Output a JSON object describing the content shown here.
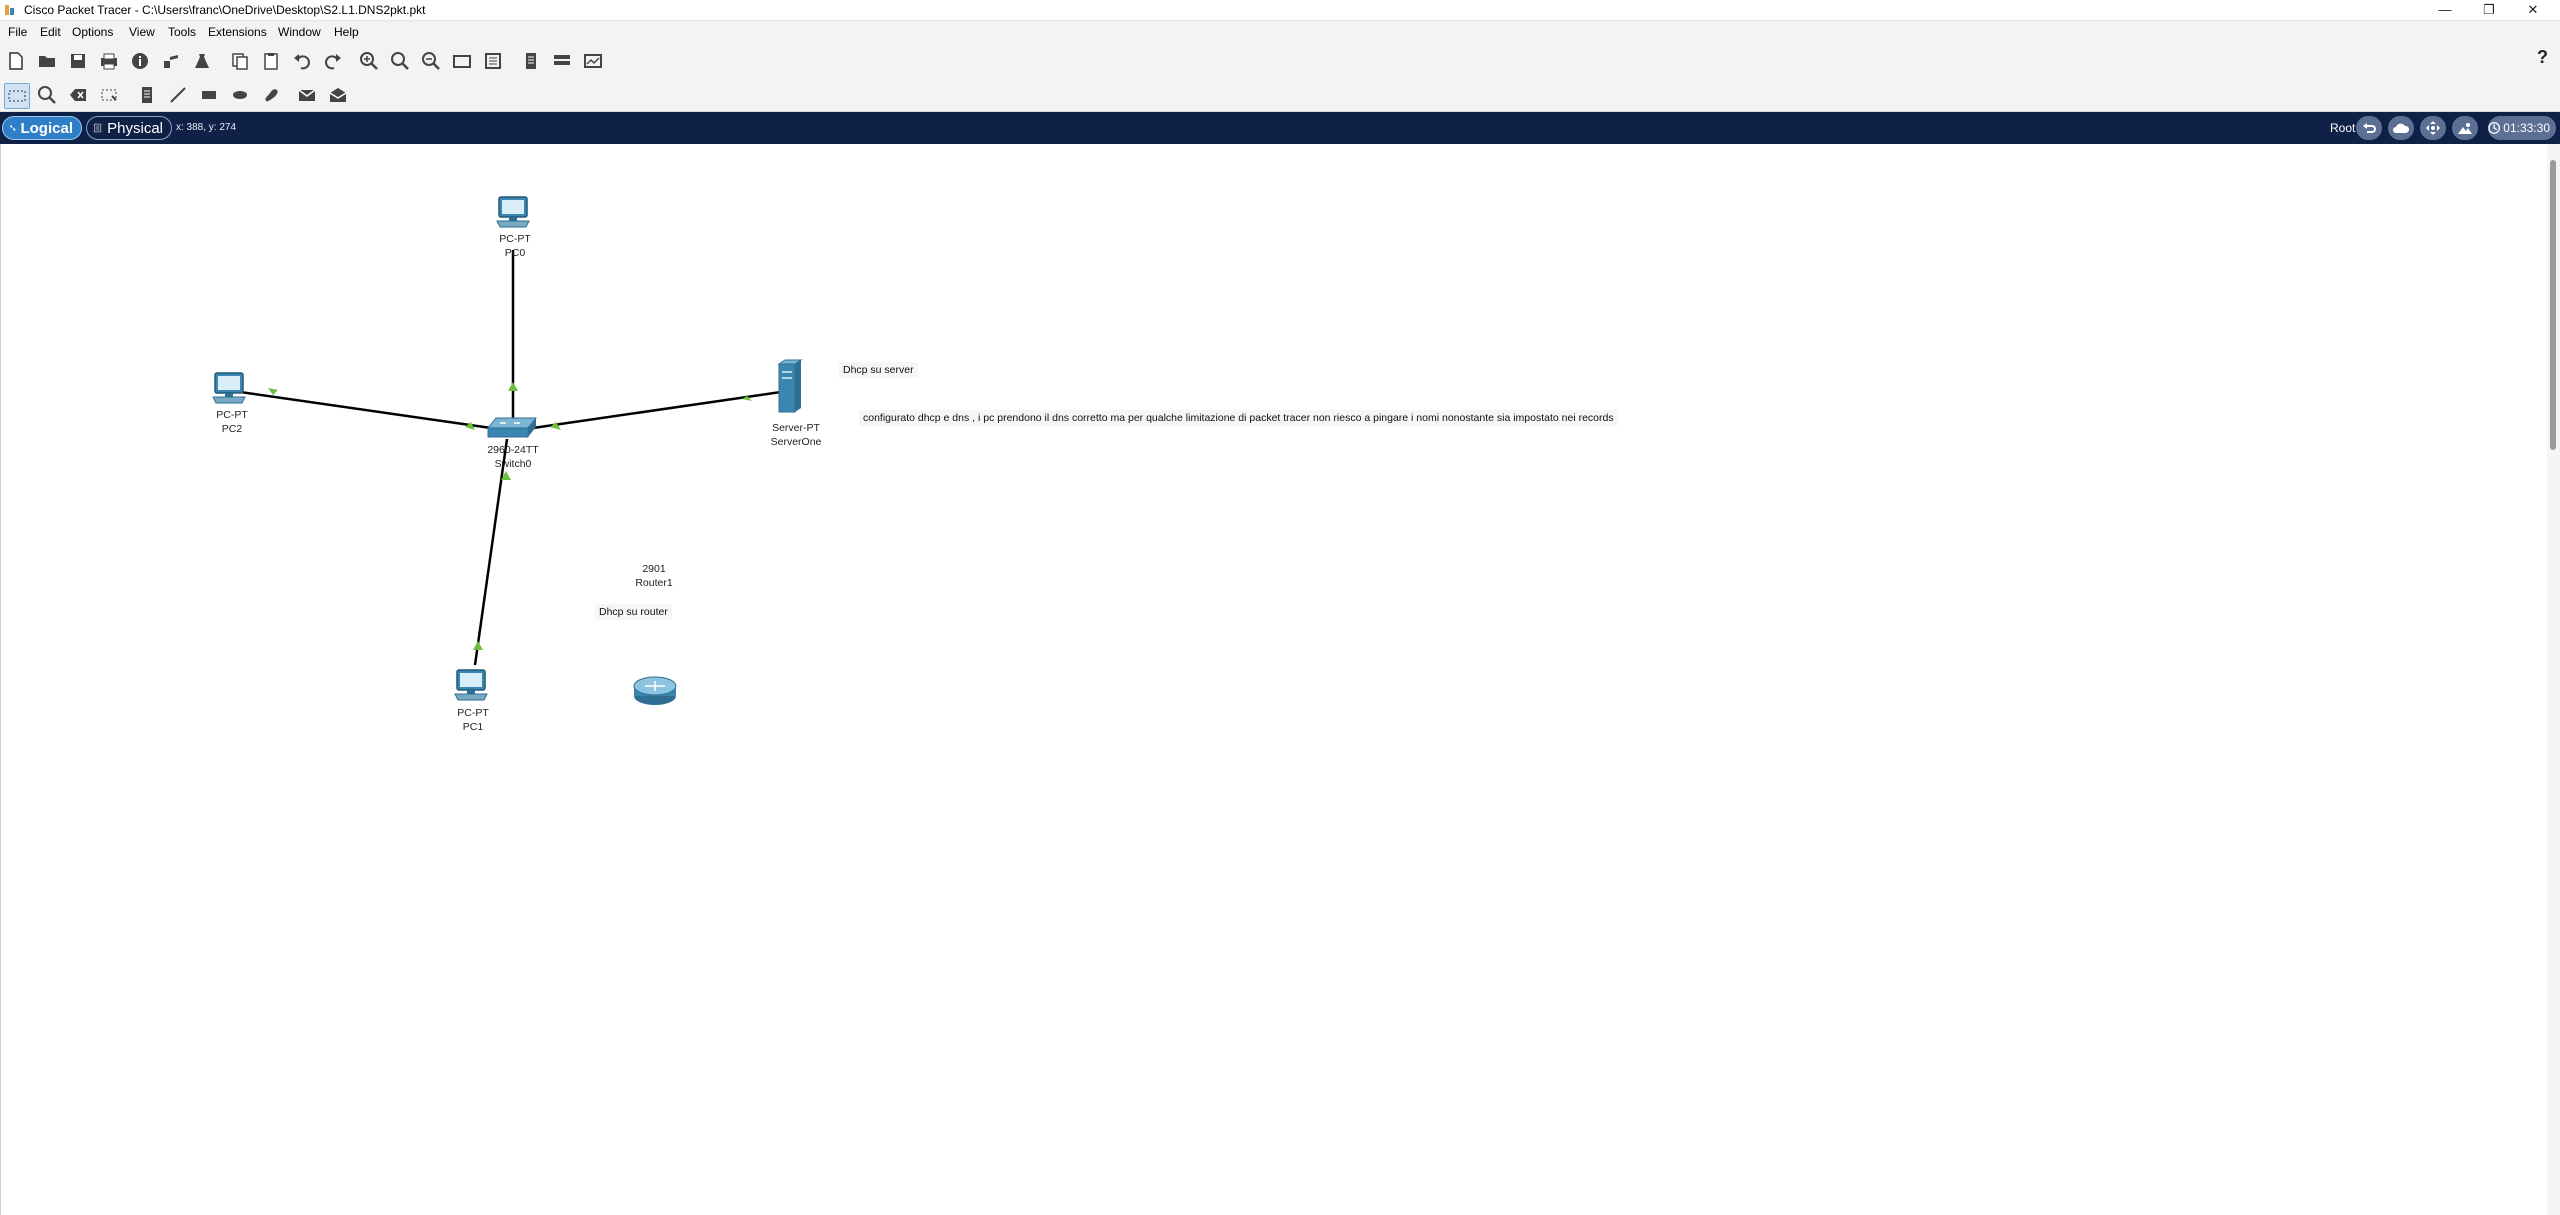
{
  "window": {
    "title": "Cisco Packet Tracer - C:\\Users\\franc\\OneDrive\\Desktop\\S2.L1.DNS2pkt.pkt",
    "controls": [
      "minimize-icon",
      "restore-icon",
      "close-icon"
    ]
  },
  "menu": [
    "File",
    "Edit",
    "Options",
    "View",
    "Tools",
    "Extensions",
    "Window",
    "Help"
  ],
  "toolbar_main": {
    "icons": [
      "new-file-icon",
      "open-folder-icon",
      "save-icon",
      "print-icon",
      "info-icon",
      "network-wizard-icon",
      "activity-wizard-icon",
      "copy-icon",
      "paste-icon",
      "undo-icon",
      "redo-icon",
      "zoom-in-icon",
      "zoom-reset-icon",
      "zoom-out-icon",
      "drawing-palette-icon",
      "custom-devices-icon",
      "view-palette-icon",
      "cluster-icon",
      "pdu-icon"
    ],
    "help_label": "?"
  },
  "toolbar_edit": {
    "icons": [
      "select-icon",
      "inspect-icon",
      "delete-icon",
      "resize-icon",
      "note-icon",
      "draw-line-icon",
      "draw-rectangle-icon",
      "draw-ellipse-icon",
      "freeform-icon",
      "simple-pdu-icon",
      "complex-pdu-icon"
    ]
  },
  "modebar": {
    "logical_label": "Logical",
    "physical_label": "Physical",
    "coords": "x: 388, y: 274",
    "root_label": "Root",
    "clock": "01:33:30",
    "controls": [
      "back-icon",
      "cloud-icon",
      "move-icon",
      "viewport-icon",
      "realtime-icon"
    ]
  },
  "devices": [
    {
      "id": "pc0",
      "model": "PC-PT",
      "name": "PC0"
    },
    {
      "id": "pc2",
      "model": "PC-PT",
      "name": "PC2"
    },
    {
      "id": "pc1",
      "model": "PC-PT",
      "name": "PC1"
    },
    {
      "id": "switch0",
      "model": "2960-24TT",
      "name": "Switch0"
    },
    {
      "id": "server",
      "model": "Server-PT",
      "name": "ServerOne"
    },
    {
      "id": "router1",
      "model": "2901",
      "name": "Router1"
    }
  ],
  "links": [
    {
      "from": "switch0",
      "to": "pc0",
      "status": "up"
    },
    {
      "from": "switch0",
      "to": "pc2",
      "status": "up"
    },
    {
      "from": "switch0",
      "to": "server",
      "status": "up"
    },
    {
      "from": "switch0",
      "to": "pc1",
      "status": "up"
    }
  ],
  "notes": {
    "dhcp_server": "Dhcp su server",
    "config": "configurato dhcp e dns , i pc prendono il dns corretto ma per qualche limitazione di packet tracer non riesco a pingare i nomi nonostante sia  impostato  nei records",
    "dhcp_router": "Dhcp su router"
  },
  "colors": {
    "mode_bar": "#0f2147",
    "link": "#000000",
    "link_up": "#4caf50",
    "device": "#3a86b0"
  }
}
